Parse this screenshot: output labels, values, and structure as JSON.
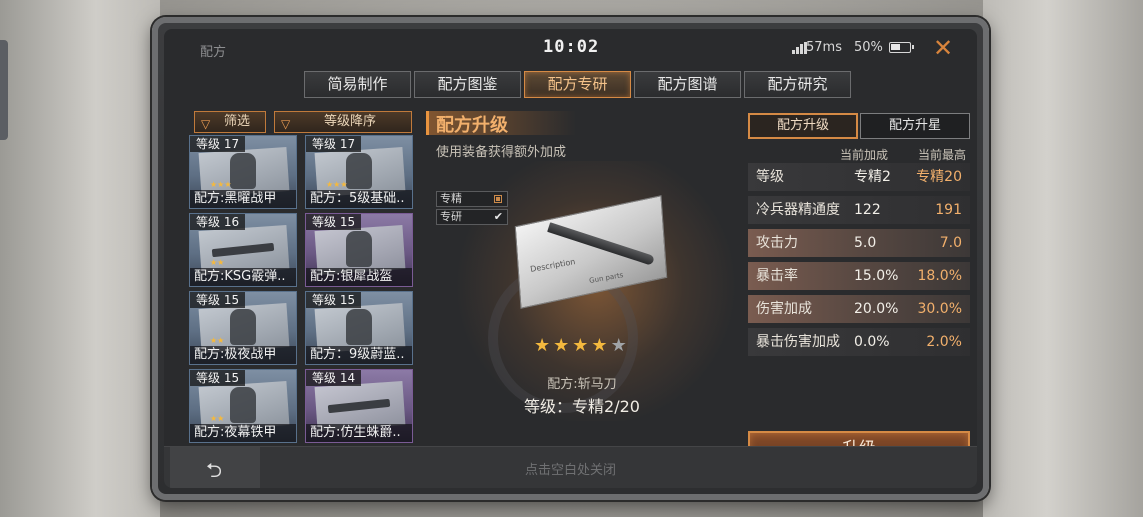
{
  "window": {
    "title": "配方",
    "clock": "10:02",
    "ping": "57ms",
    "battery": "50%",
    "battery_level": 0.5
  },
  "tabs": [
    {
      "label": "简易制作",
      "active": false
    },
    {
      "label": "配方图鉴",
      "active": false
    },
    {
      "label": "配方专研",
      "active": true
    },
    {
      "label": "配方图谱",
      "active": false
    },
    {
      "label": "配方研究",
      "active": false
    }
  ],
  "filters": {
    "filter_label": "筛选",
    "sort_label": "等级降序"
  },
  "cards": [
    {
      "level": "等级 17",
      "name": "配方:黑曜战甲",
      "stars": 3,
      "color": "blue",
      "art": "figure"
    },
    {
      "level": "等级 17",
      "name": "配方：5级基础..",
      "stars": 3,
      "color": "blue",
      "art": "figure"
    },
    {
      "level": "等级 16",
      "name": "配方:KSG霰弹..",
      "stars": 2,
      "color": "blue",
      "art": "gun"
    },
    {
      "level": "等级 15",
      "name": "配方:银犀战盔",
      "stars": 0,
      "color": "purple",
      "art": "figure"
    },
    {
      "level": "等级 15",
      "name": "配方:极夜战甲",
      "stars": 2,
      "color": "blue",
      "art": "figure"
    },
    {
      "level": "等级 15",
      "name": "配方：9级蔚蓝..",
      "stars": 0,
      "color": "blue",
      "art": "figure"
    },
    {
      "level": "等级 15",
      "name": "配方:夜幕铁甲",
      "stars": 2,
      "color": "blue",
      "art": "figure"
    },
    {
      "level": "等级 14",
      "name": "配方:仿生蛛爵..",
      "stars": 0,
      "color": "purple",
      "art": "gun"
    }
  ],
  "center": {
    "title": "配方升级",
    "subtitle": "使用装备获得额外加成",
    "checks": [
      {
        "label": "专精",
        "type": "box"
      },
      {
        "label": "专研",
        "type": "check"
      }
    ],
    "blueprint_text_1": "Description",
    "blueprint_text_2": "Gun parts",
    "stars_filled": 4,
    "stars_total": 5,
    "item_name": "配方:斩马刀",
    "item_level": "等级：专精2/20"
  },
  "right": {
    "tabs": [
      {
        "label": "配方升级",
        "active": true
      },
      {
        "label": "配方升星",
        "active": false
      }
    ],
    "col_current": "当前加成",
    "col_max": "当前最高",
    "stats": [
      {
        "name": "等级",
        "current": "专精2",
        "max": "专精20",
        "style": "plain"
      },
      {
        "name": "冷兵器精通度",
        "current": "122",
        "max": "191",
        "style": "plain"
      },
      {
        "name": "攻击力",
        "current": "5.0",
        "max": "7.0",
        "style": "hi"
      },
      {
        "name": "暴击率",
        "current": "15.0%",
        "max": "18.0%",
        "style": "hi"
      },
      {
        "name": "伤害加成",
        "current": "20.0%",
        "max": "30.0%",
        "style": "hi"
      },
      {
        "name": "暴击伤害加成",
        "current": "0.0%",
        "max": "2.0%",
        "style": "plain"
      }
    ],
    "upgrade_label": "升级"
  },
  "bottom": {
    "close_hint": "点击空白处关闭"
  },
  "colors": {
    "accent": "#d58a45",
    "title_orange": "#f2b06c",
    "star": "#f4b93e"
  }
}
